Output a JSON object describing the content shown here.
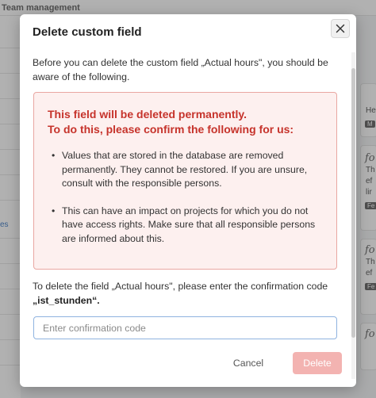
{
  "background": {
    "header_title": "Team management",
    "left_link_fragment": "es",
    "right_cards": [
      {
        "line1": "He",
        "tag": "M"
      },
      {
        "glyph": "fo",
        "line1": "Th",
        "line2": "ef",
        "line3": "lir",
        "tag": "Fe"
      },
      {
        "glyph": "fo",
        "line1": "Th",
        "line2": "ef",
        "tag": "Fe"
      },
      {
        "glyph": "fo"
      }
    ]
  },
  "modal": {
    "title": "Delete custom field",
    "close_icon": "close-icon",
    "intro": "Before you can delete the custom field „Actual hours\", you should be aware of the following.",
    "warning": {
      "title_line1": "This field will be deleted permanently.",
      "title_line2": "To do this, please confirm the following for us:",
      "items": [
        "Values that are stored in the database are removed permanently. They cannot be restored. If you are unsure, consult with the responsible persons.",
        "This can have an impact on projects for which you do not have access rights. Make sure that all responsible persons are informed about this."
      ]
    },
    "confirm_text": "To delete the field „Actual hours\", please enter the confirmation code",
    "confirm_code": "„ist_stunden“.",
    "input": {
      "placeholder": "Enter confirmation code",
      "value": ""
    },
    "cancel_label": "Cancel",
    "delete_label": "Delete"
  },
  "colors": {
    "warning_text": "#c6332b",
    "warning_bg": "#fdf0ef",
    "warning_border": "#e9a7a2",
    "delete_disabled": "#f3b3b1",
    "input_focus_border": "#8fb3e0"
  }
}
